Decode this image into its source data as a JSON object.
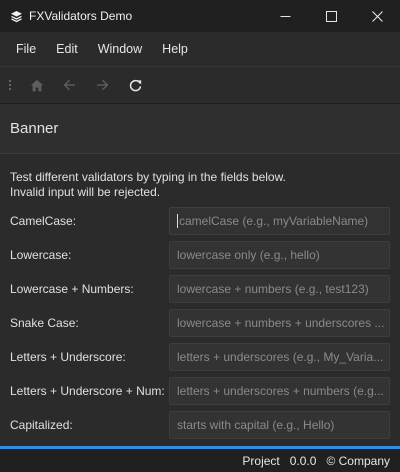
{
  "window": {
    "title": "FXValidators Demo",
    "icon": "layers-icon",
    "controls": [
      "minimize-icon",
      "maximize-icon",
      "close-icon"
    ]
  },
  "menu": [
    "File",
    "Edit",
    "Window",
    "Help"
  ],
  "toolbar": {
    "buttons": [
      {
        "icon": "home-icon",
        "enabled": false
      },
      {
        "icon": "back-arrow-icon",
        "enabled": false
      },
      {
        "icon": "forward-arrow-icon",
        "enabled": false
      },
      {
        "icon": "refresh-icon",
        "enabled": true
      }
    ]
  },
  "banner": {
    "title": "Banner"
  },
  "instructions": {
    "line1": "Test different validators by typing in the fields below.",
    "line2": "Invalid input will be rejected."
  },
  "validators": [
    {
      "label": "CamelCase:",
      "placeholder": "camelCase (e.g., myVariableName)",
      "focused": true
    },
    {
      "label": "Lowercase:",
      "placeholder": "lowercase only (e.g., hello)",
      "focused": false
    },
    {
      "label": "Lowercase + Numbers:",
      "placeholder": "lowercase + numbers (e.g., test123)",
      "focused": false
    },
    {
      "label": "Snake Case:",
      "placeholder": "lowercase + numbers + underscores ...",
      "focused": false
    },
    {
      "label": "Letters + Underscore:",
      "placeholder": "letters + underscores (e.g., My_Varia...",
      "focused": false
    },
    {
      "label": "Letters + Underscore + Num:",
      "placeholder": "letters + underscores + numbers (e.g...",
      "focused": false
    },
    {
      "label": "Capitalized:",
      "placeholder": "starts with capital (e.g., Hello)",
      "focused": false
    }
  ],
  "status": {
    "project": "Project",
    "version": "0.0.0",
    "company": "© Company"
  },
  "colors": {
    "accent": "#2f8fe0",
    "background": "#2b2b2b",
    "titlebar": "#202020"
  }
}
